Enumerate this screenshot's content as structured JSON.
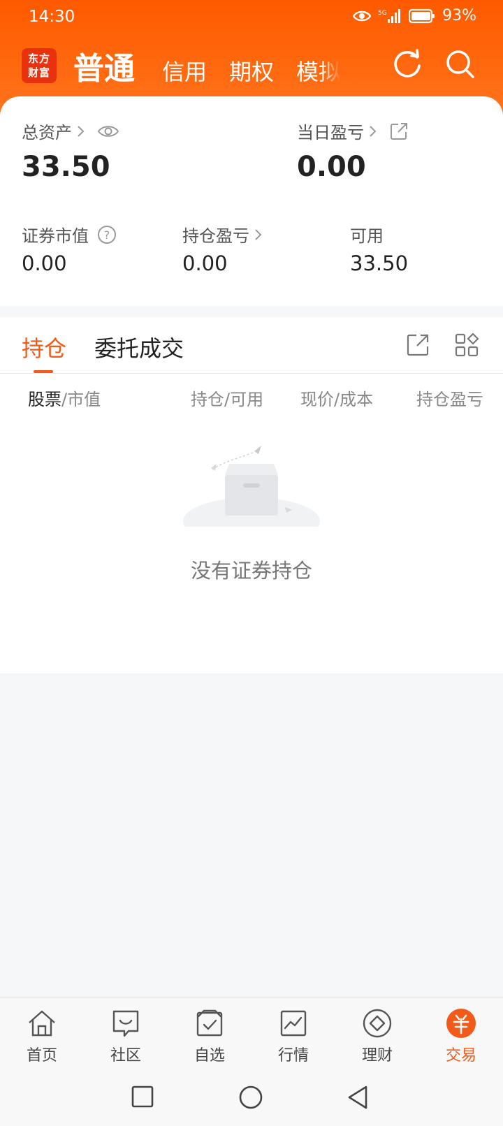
{
  "status_bar": {
    "time": "14:30",
    "battery": "93%",
    "network": "5G"
  },
  "header": {
    "logo_line1": "东方",
    "logo_line2": "财富",
    "tabs": [
      {
        "label": "普通",
        "active": true
      },
      {
        "label": "信用"
      },
      {
        "label": "期权"
      },
      {
        "label": "模拟"
      }
    ]
  },
  "summary": {
    "total_assets_label": "总资产",
    "total_assets_value": "33.50",
    "daily_pnl_label": "当日盈亏",
    "daily_pnl_value": "0.00",
    "market_value_label": "证券市值",
    "market_value": "0.00",
    "position_pnl_label": "持仓盈亏",
    "position_pnl": "0.00",
    "available_label": "可用",
    "available": "33.50"
  },
  "holdings": {
    "tabs": [
      {
        "label": "持仓",
        "active": true
      },
      {
        "label": "委托成交"
      }
    ],
    "columns": {
      "stock": "股票",
      "stock_sub": "/市值",
      "position": "持仓/可用",
      "price": "现价/成本",
      "pnl": "持仓盈亏"
    },
    "empty_text": "没有证券持仓"
  },
  "bottom_nav": [
    {
      "label": "首页",
      "icon": "home-icon"
    },
    {
      "label": "社区",
      "icon": "community-icon"
    },
    {
      "label": "自选",
      "icon": "watchlist-icon"
    },
    {
      "label": "行情",
      "icon": "market-icon"
    },
    {
      "label": "理财",
      "icon": "finance-icon"
    },
    {
      "label": "交易",
      "icon": "trade-icon",
      "active": true
    }
  ],
  "colors": {
    "accent": "#f25a1a",
    "header": "#ff5a00"
  }
}
